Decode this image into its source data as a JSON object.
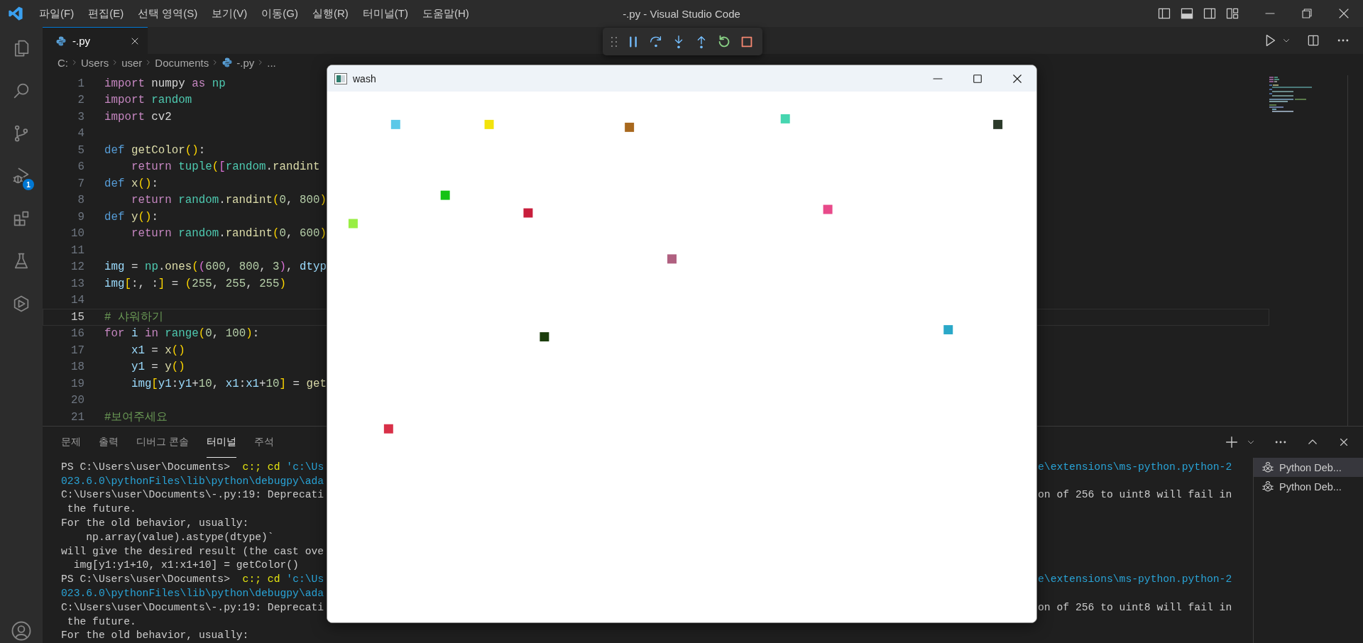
{
  "title_bar": {
    "menu": [
      "파일(F)",
      "편집(E)",
      "선택 영역(S)",
      "보기(V)",
      "이동(G)",
      "실행(R)",
      "터미널(T)",
      "도움말(H)"
    ],
    "title": "-.py - Visual Studio Code"
  },
  "activity_bar": {
    "debug_badge": "1"
  },
  "editor": {
    "tabs": [
      {
        "label": "-.py",
        "selected": true
      }
    ],
    "breadcrumb": [
      {
        "kind": "folder",
        "label": "C:"
      },
      {
        "kind": "folder",
        "label": "Users"
      },
      {
        "kind": "folder",
        "label": "user"
      },
      {
        "kind": "folder",
        "label": "Documents"
      },
      {
        "kind": "file",
        "label": "-.py"
      },
      {
        "kind": "more",
        "label": "..."
      }
    ],
    "lines": [
      {
        "number": "1",
        "current": false,
        "tokens": [
          {
            "kind": "control",
            "text": "import"
          },
          {
            "kind": "plain",
            "text": " numpy "
          },
          {
            "kind": "control",
            "text": "as"
          },
          {
            "kind": "module",
            "text": " np"
          }
        ]
      },
      {
        "number": "2",
        "current": false,
        "tokens": [
          {
            "kind": "control",
            "text": "import"
          },
          {
            "kind": "module",
            "text": " random"
          }
        ]
      },
      {
        "number": "3",
        "current": false,
        "tokens": [
          {
            "kind": "control",
            "text": "import"
          },
          {
            "kind": "plain",
            "text": " cv2"
          }
        ]
      },
      {
        "number": "4",
        "current": false
      },
      {
        "number": "5",
        "current": false,
        "tokens": [
          {
            "kind": "keyword",
            "text": "def"
          },
          {
            "kind": "func",
            "text": " getColor"
          },
          {
            "kind": "bracket1",
            "text": "()"
          },
          {
            "kind": "plain",
            "text": ":"
          }
        ]
      },
      {
        "number": "6",
        "current": false,
        "tokens": [
          {
            "kind": "control",
            "text": "    return"
          },
          {
            "kind": "module",
            "text": " tuple"
          },
          {
            "kind": "bracket1",
            "text": "("
          },
          {
            "kind": "bracket2",
            "text": "["
          },
          {
            "kind": "module",
            "text": "random"
          },
          {
            "kind": "plain",
            "text": "."
          },
          {
            "kind": "func",
            "text": "randint"
          }
        ]
      },
      {
        "number": "7",
        "current": false,
        "tokens": [
          {
            "kind": "keyword",
            "text": "def"
          },
          {
            "kind": "func",
            "text": " x"
          },
          {
            "kind": "bracket1",
            "text": "()"
          },
          {
            "kind": "plain",
            "text": ":"
          }
        ]
      },
      {
        "number": "8",
        "current": false,
        "tokens": [
          {
            "kind": "control",
            "text": "    return"
          },
          {
            "kind": "module",
            "text": " random"
          },
          {
            "kind": "plain",
            "text": "."
          },
          {
            "kind": "func",
            "text": "randint"
          },
          {
            "kind": "bracket1",
            "text": "("
          },
          {
            "kind": "num",
            "text": "0"
          },
          {
            "kind": "plain",
            "text": ", "
          },
          {
            "kind": "num",
            "text": "800"
          },
          {
            "kind": "bracket1",
            "text": ")"
          }
        ]
      },
      {
        "number": "9",
        "current": false,
        "tokens": [
          {
            "kind": "keyword",
            "text": "def"
          },
          {
            "kind": "func",
            "text": " y"
          },
          {
            "kind": "bracket1",
            "text": "()"
          },
          {
            "kind": "plain",
            "text": ":"
          }
        ]
      },
      {
        "number": "10",
        "current": false,
        "tokens": [
          {
            "kind": "control",
            "text": "    return"
          },
          {
            "kind": "module",
            "text": " random"
          },
          {
            "kind": "plain",
            "text": "."
          },
          {
            "kind": "func",
            "text": "randint"
          },
          {
            "kind": "bracket1",
            "text": "("
          },
          {
            "kind": "num",
            "text": "0"
          },
          {
            "kind": "plain",
            "text": ", "
          },
          {
            "kind": "num",
            "text": "600"
          },
          {
            "kind": "bracket1",
            "text": ")"
          }
        ]
      },
      {
        "number": "11",
        "current": false
      },
      {
        "number": "12",
        "current": false,
        "tokens": [
          {
            "kind": "var",
            "text": "img"
          },
          {
            "kind": "plain",
            "text": " = "
          },
          {
            "kind": "module",
            "text": "np"
          },
          {
            "kind": "plain",
            "text": "."
          },
          {
            "kind": "func",
            "text": "ones"
          },
          {
            "kind": "bracket1",
            "text": "("
          },
          {
            "kind": "bracket2",
            "text": "("
          },
          {
            "kind": "num",
            "text": "600"
          },
          {
            "kind": "plain",
            "text": ", "
          },
          {
            "kind": "num",
            "text": "800"
          },
          {
            "kind": "plain",
            "text": ", "
          },
          {
            "kind": "num",
            "text": "3"
          },
          {
            "kind": "bracket2",
            "text": ")"
          },
          {
            "kind": "plain",
            "text": ", "
          },
          {
            "kind": "var",
            "text": "dtyp"
          }
        ]
      },
      {
        "number": "13",
        "current": false,
        "tokens": [
          {
            "kind": "var",
            "text": "img"
          },
          {
            "kind": "bracket1",
            "text": "["
          },
          {
            "kind": "plain",
            "text": ":, :"
          },
          {
            "kind": "bracket1",
            "text": "]"
          },
          {
            "kind": "plain",
            "text": " = "
          },
          {
            "kind": "bracket1",
            "text": "("
          },
          {
            "kind": "num",
            "text": "255"
          },
          {
            "kind": "plain",
            "text": ", "
          },
          {
            "kind": "num",
            "text": "255"
          },
          {
            "kind": "plain",
            "text": ", "
          },
          {
            "kind": "num",
            "text": "255"
          },
          {
            "kind": "bracket1",
            "text": ")"
          }
        ]
      },
      {
        "number": "14",
        "current": false
      },
      {
        "number": "15",
        "current": true,
        "tokens": [
          {
            "kind": "comment",
            "text": "# 샤워하기"
          }
        ]
      },
      {
        "number": "16",
        "current": false,
        "tokens": [
          {
            "kind": "control",
            "text": "for"
          },
          {
            "kind": "var",
            "text": " i"
          },
          {
            "kind": "control",
            "text": " in"
          },
          {
            "kind": "module",
            "text": " range"
          },
          {
            "kind": "bracket1",
            "text": "("
          },
          {
            "kind": "num",
            "text": "0"
          },
          {
            "kind": "plain",
            "text": ", "
          },
          {
            "kind": "num",
            "text": "100"
          },
          {
            "kind": "bracket1",
            "text": ")"
          },
          {
            "kind": "plain",
            "text": ":"
          }
        ]
      },
      {
        "number": "17",
        "current": false,
        "tokens": [
          {
            "kind": "var",
            "text": "    x1"
          },
          {
            "kind": "plain",
            "text": " = "
          },
          {
            "kind": "func",
            "text": "x"
          },
          {
            "kind": "bracket1",
            "text": "()"
          }
        ]
      },
      {
        "number": "18",
        "current": false,
        "tokens": [
          {
            "kind": "var",
            "text": "    y1"
          },
          {
            "kind": "plain",
            "text": " = "
          },
          {
            "kind": "func",
            "text": "y"
          },
          {
            "kind": "bracket1",
            "text": "()"
          }
        ]
      },
      {
        "number": "19",
        "current": false,
        "tokens": [
          {
            "kind": "var",
            "text": "    img"
          },
          {
            "kind": "bracket1",
            "text": "["
          },
          {
            "kind": "var",
            "text": "y1"
          },
          {
            "kind": "plain",
            "text": ":"
          },
          {
            "kind": "var",
            "text": "y1"
          },
          {
            "kind": "plain",
            "text": "+"
          },
          {
            "kind": "num",
            "text": "10"
          },
          {
            "kind": "plain",
            "text": ", "
          },
          {
            "kind": "var",
            "text": "x1"
          },
          {
            "kind": "plain",
            "text": ":"
          },
          {
            "kind": "var",
            "text": "x1"
          },
          {
            "kind": "plain",
            "text": "+"
          },
          {
            "kind": "num",
            "text": "10"
          },
          {
            "kind": "bracket1",
            "text": "]"
          },
          {
            "kind": "plain",
            "text": " = "
          },
          {
            "kind": "func",
            "text": "get"
          }
        ]
      },
      {
        "number": "20",
        "current": false
      },
      {
        "number": "21",
        "current": false,
        "tokens": [
          {
            "kind": "comment",
            "text": "#보여주세요"
          }
        ]
      }
    ]
  },
  "panel": {
    "tabs": [
      {
        "label": "문제",
        "selected": false
      },
      {
        "label": "출력",
        "selected": false
      },
      {
        "label": "디버그 콘솔",
        "selected": false
      },
      {
        "label": "터미널",
        "selected": true
      },
      {
        "label": "주석",
        "selected": false
      }
    ],
    "terminal_lines": [
      {
        "left": [
          {
            "kind": "plain",
            "text": "PS C:\\Users\\user\\Documents>  "
          },
          {
            "kind": "command",
            "text": "c:; cd"
          },
          {
            "kind": "string",
            "text": " 'c:\\Us"
          }
        ],
        "right": [
          {
            "kind": "string",
            "text": "e\\extensions\\ms-python.python-2"
          }
        ]
      },
      {
        "left": [
          {
            "kind": "string",
            "text": "023.6.0\\pythonFiles\\lib\\python\\debugpy\\ada"
          }
        ]
      },
      {
        "left": [
          {
            "kind": "plain",
            "text": "C:\\Users\\user\\Documents\\-.py:19: Deprecati"
          }
        ],
        "right": [
          {
            "kind": "plain",
            "text": "on of 256 to uint8 will fail in"
          }
        ]
      },
      {
        "left": [
          {
            "kind": "plain",
            "text": " the future."
          }
        ]
      },
      {
        "left": [
          {
            "kind": "plain",
            "text": "For the old behavior, usually:"
          }
        ]
      },
      {
        "left": [
          {
            "kind": "plain",
            "text": "    np.array(value).astype(dtype)`"
          }
        ]
      },
      {
        "left": [
          {
            "kind": "plain",
            "text": "will give the desired result (the cast ove"
          }
        ]
      },
      {
        "left": [
          {
            "kind": "plain",
            "text": "  img[y1:y1+10, x1:x1+10] = getColor()"
          }
        ]
      },
      {
        "left": [
          {
            "kind": "plain",
            "text": "PS C:\\Users\\user\\Documents>  "
          },
          {
            "kind": "command",
            "text": "c:; cd"
          },
          {
            "kind": "string",
            "text": " 'c:\\Us"
          }
        ],
        "right": [
          {
            "kind": "string",
            "text": "e\\extensions\\ms-python.python-2"
          }
        ]
      },
      {
        "left": [
          {
            "kind": "string",
            "text": "023.6.0\\pythonFiles\\lib\\python\\debugpy\\ada"
          }
        ]
      },
      {
        "left": [
          {
            "kind": "plain",
            "text": "C:\\Users\\user\\Documents\\-.py:19: Deprecati"
          }
        ],
        "right": [
          {
            "kind": "plain",
            "text": "on of 256 to uint8 will fail in"
          }
        ]
      },
      {
        "left": [
          {
            "kind": "plain",
            "text": " the future."
          }
        ]
      },
      {
        "left": [
          {
            "kind": "plain",
            "text": "For the old behavior, usually:"
          }
        ]
      }
    ],
    "sessions": [
      {
        "label": "Python Deb...",
        "selected": true
      },
      {
        "label": "Python Deb...",
        "selected": false
      }
    ]
  },
  "image_window": {
    "title": "wash"
  }
}
